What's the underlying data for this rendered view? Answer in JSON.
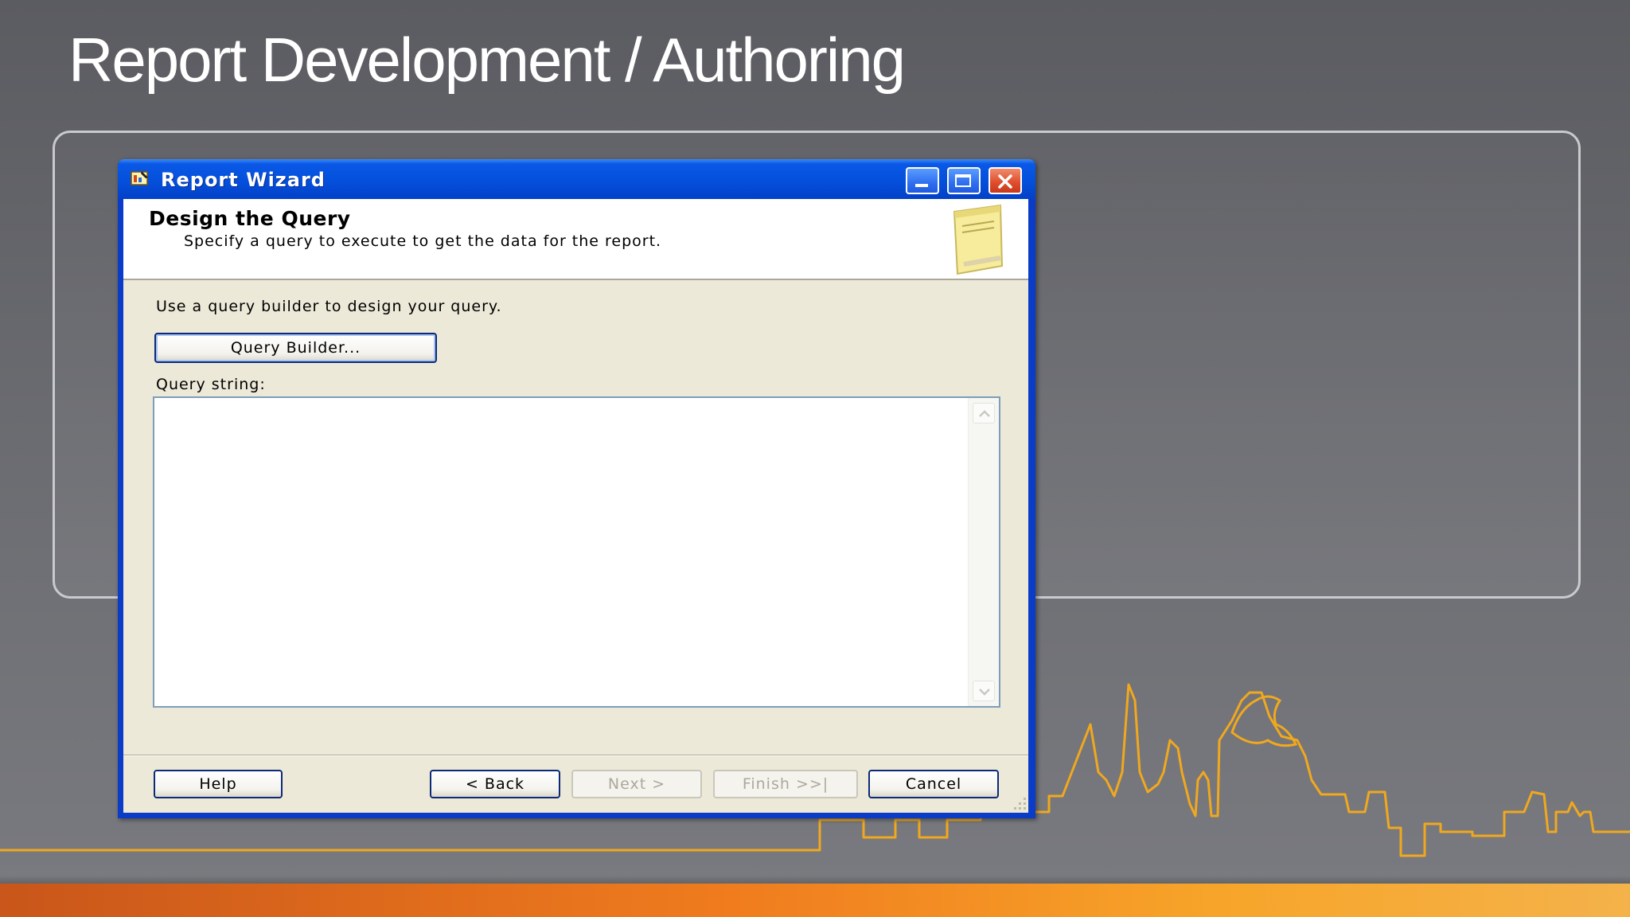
{
  "slide": {
    "title": "Report Development / Authoring"
  },
  "dialog": {
    "title": "Report Wizard",
    "header_title": "Design the Query",
    "header_subtitle": "Specify a query to execute to get the data for the report.",
    "instruction": "Use a query builder to design your query.",
    "query_builder_label": "Query Builder...",
    "query_string_label": "Query string:",
    "query_string_value": "",
    "buttons": {
      "help": "Help",
      "back": "< Back",
      "next": "Next >",
      "finish": "Finish >>|",
      "cancel": "Cancel"
    },
    "disabled_buttons": [
      "Next >",
      "Finish >>|"
    ]
  },
  "colors": {
    "titlebar_blue": "#0450dc",
    "dialog_face": "#ece9d8",
    "skyline_stroke": "#f0a81e",
    "bottom_bar_orange": "#f07c1e"
  },
  "icons": [
    "wizard-app-icon",
    "minimize-icon",
    "maximize-icon",
    "close-icon",
    "notepad-icon",
    "scroll-up-icon",
    "scroll-down-icon",
    "resize-grip-icon"
  ]
}
